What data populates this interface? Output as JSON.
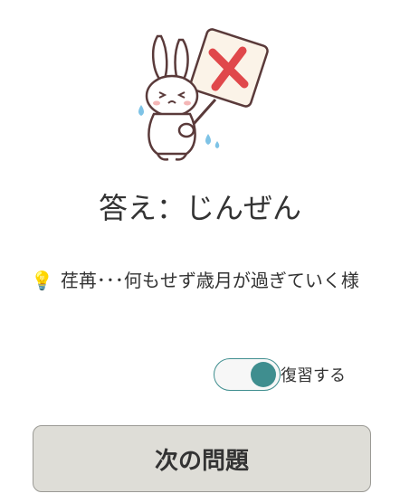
{
  "mascot": {
    "icon": "rabbit-holding-x-sign-icon"
  },
  "answer": {
    "text": "答え：じんぜん"
  },
  "hint": {
    "icon": "lightbulb-icon",
    "emoji": "💡",
    "text": "荏苒･･･何もせず歳月が過ぎていく様"
  },
  "review": {
    "label": "復習する",
    "enabled": true,
    "accent_color": "#3f8e8f"
  },
  "next": {
    "label": "次の問題"
  },
  "colors": {
    "button_bg": "#deddd7",
    "x_mark": "#e0484b",
    "text": "#333333"
  }
}
